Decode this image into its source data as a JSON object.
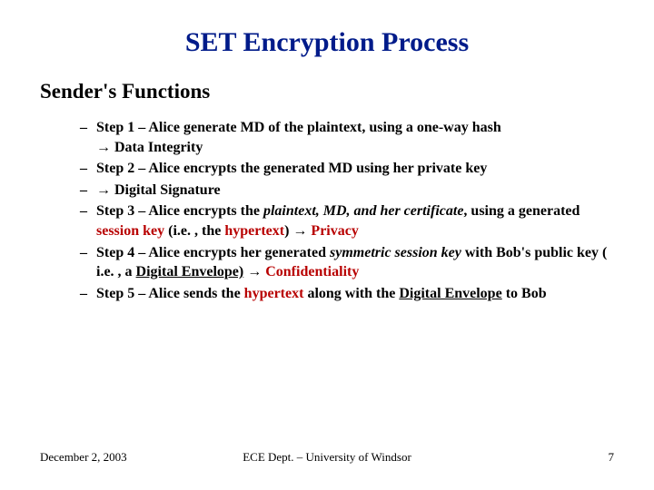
{
  "title": "SET Encryption Process",
  "subhead": "Sender's Functions",
  "arrow": "→",
  "steps": {
    "s1_a": "Step 1 – Alice generate MD of the plaintext, using a one-way hash",
    "s1_b": " Data Integrity",
    "s2": "Step 2 – Alice encrypts the generated MD using her private key",
    "s3": " Digital Signature",
    "s4_a": "Step 3 – Alice encrypts the ",
    "s4_b": "plaintext, MD, and her certificate",
    "s4_c": ", using a generated ",
    "s4_d": "session key",
    "s4_e": " (i.e. , the ",
    "s4_f": "hypertext",
    "s4_g": ") ",
    "s4_h": " Privacy",
    "s5_a": "Step 4 – Alice encrypts her generated ",
    "s5_b": "symmetric session key",
    "s5_c": " with Bob's public key ( i.e. , a ",
    "s5_d": "Digital Envelope)",
    "s5_e": " ",
    "s5_f": " Confidentiality",
    "s6_a": " Step 5 – Alice sends the ",
    "s6_b": "hypertext",
    "s6_c": " along with the ",
    "s6_d": "Digital Envelope",
    "s6_e": " to Bob"
  },
  "footer": {
    "date": "December 2, 2003",
    "center": "ECE Dept. – University of Windsor",
    "page": "7"
  }
}
